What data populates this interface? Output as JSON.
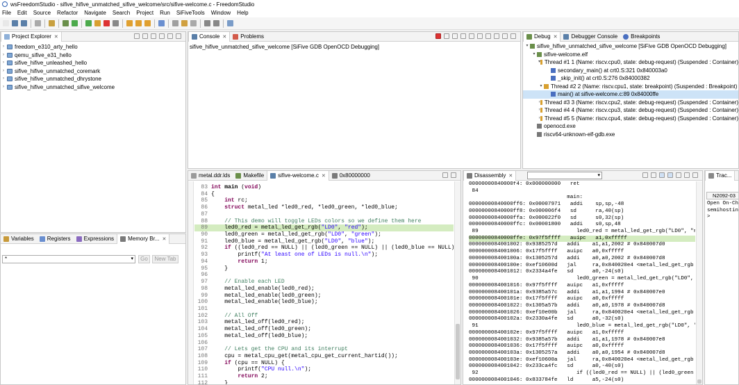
{
  "window": {
    "title": "wsFreedomStudio - sifive_hifive_unmatched_sifive_welcome/src/sifive-welcome.c - FreedomStudio"
  },
  "menu": [
    "File",
    "Edit",
    "Source",
    "Refactor",
    "Navigate",
    "Search",
    "Project",
    "Run",
    "SiFiveTools",
    "Window",
    "Help"
  ],
  "project_explorer": {
    "tab": "Project Explorer",
    "items": [
      "freedom_e310_arty_hello",
      "qemu_sifive_e31_hello",
      "sifive_hifive_unleashed_hello",
      "sifive_hifive_unmatched_coremark",
      "sifive_hifive_unmatched_dhrystone",
      "sifive_hifive_unmatched_sifive_welcome"
    ]
  },
  "console": {
    "tabs": [
      "Console",
      "Problems"
    ],
    "session": "sifive_hifive_unmatched_sifive_welcome [SiFive GDB OpenOCD Debugging]"
  },
  "debug": {
    "tabs": [
      "Debug",
      "Debugger Console",
      "Breakpoints"
    ],
    "rows": [
      {
        "indent": 0,
        "text": "sifive_hifive_unmatched_sifive_welcome [SiFive GDB OpenOCD Debugging]",
        "twisty": "▾"
      },
      {
        "indent": 1,
        "text": "sifive-welcome.elf",
        "twisty": "▾"
      },
      {
        "indent": 2,
        "text": "Thread #1 1 (Name: riscv.cpu0, state: debug-request) (Suspended : Container)",
        "twisty": "▾"
      },
      {
        "indent": 3,
        "text": "secondary_main() at crt0.S:321 0x840003a0",
        "twisty": ""
      },
      {
        "indent": 3,
        "text": "_skip_init() at crt0.S:276 0x84000382",
        "twisty": ""
      },
      {
        "indent": 2,
        "text": "Thread #2 2 (Name: riscv.cpu1, state: breakpoint) (Suspended : Breakpoint)",
        "twisty": "▾"
      },
      {
        "indent": 3,
        "text": "main() at sifive-welcome.c:89 0x84000ffe",
        "twisty": "",
        "selected": true
      },
      {
        "indent": 2,
        "text": "Thread #3 3 (Name: riscv.cpu2, state: debug-request) (Suspended : Container)",
        "twisty": "›"
      },
      {
        "indent": 2,
        "text": "Thread #4 4 (Name: riscv.cpu3, state: debug-request) (Suspended : Container)",
        "twisty": "›"
      },
      {
        "indent": 2,
        "text": "Thread #5 5 (Name: riscv.cpu4, state: debug-request) (Suspended : Container)",
        "twisty": "›"
      },
      {
        "indent": 1,
        "text": "openocd.exe",
        "twisty": ""
      },
      {
        "indent": 1,
        "text": "riscv64-unknown-elf-gdb.exe",
        "twisty": ""
      }
    ]
  },
  "variables": {
    "tabs": [
      "Variables",
      "Registers",
      "Expressions",
      "Memory Br..."
    ],
    "go": "Go",
    "new_tab": "New Tab",
    "combo_value": "*"
  },
  "editor": {
    "tabs": [
      "metal.ddr.lds",
      "Makefile",
      "sifive-welcome.c",
      "0x80000000"
    ],
    "lines": [
      {
        "n": "83",
        "html": "<span class=\"kw\">int</span> <b>main</b> (<span class=\"kw\">void</span>)"
      },
      {
        "n": "84",
        "html": "{"
      },
      {
        "n": "85",
        "html": "    <span class=\"kw\">int</span> rc;"
      },
      {
        "n": "86",
        "html": "    <span class=\"kw\">struct</span> metal_led *led0_red, *led0_green, *led0_blue;"
      },
      {
        "n": "87",
        "html": ""
      },
      {
        "n": "88",
        "html": "    <span class=\"cm\">// This demo will toggle LEDs colors so we define them here</span>"
      },
      {
        "n": "89",
        "html": "    led0_red = metal_led_get_rgb(<span class=\"st\">\"LD0\"</span>, <span class=\"st\">\"red\"</span>);",
        "hl": true
      },
      {
        "n": "90",
        "html": "    led0_green = metal_led_get_rgb(<span class=\"st\">\"LD0\"</span>, <span class=\"st\">\"green\"</span>);"
      },
      {
        "n": "91",
        "html": "    led0_blue = metal_led_get_rgb(<span class=\"st\">\"LD0\"</span>, <span class=\"st\">\"blue\"</span>);"
      },
      {
        "n": "92",
        "html": "    <span class=\"kw\">if</span> ((led0_red == NULL) || (led0_green == NULL) || (led0_blue == NULL)) {"
      },
      {
        "n": "93",
        "html": "        printf(<span class=\"st\">\"At least one of LEDs is null.\\n\"</span>);"
      },
      {
        "n": "94",
        "html": "        <span class=\"kw\">return</span> 1;"
      },
      {
        "n": "95",
        "html": "    }"
      },
      {
        "n": "96",
        "html": ""
      },
      {
        "n": "97",
        "html": "    <span class=\"cm\">// Enable each LED</span>"
      },
      {
        "n": "98",
        "html": "    metal_led_enable(led0_red);"
      },
      {
        "n": "99",
        "html": "    metal_led_enable(led0_green);"
      },
      {
        "n": "100",
        "html": "    metal_led_enable(led0_blue);"
      },
      {
        "n": "101",
        "html": ""
      },
      {
        "n": "102",
        "html": "    <span class=\"cm\">// All Off</span>"
      },
      {
        "n": "103",
        "html": "    metal_led_off(led0_red);"
      },
      {
        "n": "104",
        "html": "    metal_led_off(led0_green);"
      },
      {
        "n": "105",
        "html": "    metal_led_off(led0_blue);"
      },
      {
        "n": "106",
        "html": ""
      },
      {
        "n": "107",
        "html": "    <span class=\"cm\">// Lets get the CPU and its interrupt</span>"
      },
      {
        "n": "108",
        "html": "    cpu = metal_cpu_get(metal_cpu_get_current_hartid());"
      },
      {
        "n": "109",
        "html": "    <span class=\"kw\">if</span> (cpu == NULL) {"
      },
      {
        "n": "110",
        "html": "        printf(<span class=\"st\">\"CPU null.\\n\"</span>);"
      },
      {
        "n": "111",
        "html": "        <span class=\"kw\">return</span> 2;"
      },
      {
        "n": "112",
        "html": "    }"
      }
    ]
  },
  "disassembly": {
    "tab": "Disassembly",
    "lines": [
      {
        "t": "00000000840000f4: 0x000000000   ret"
      },
      {
        "t": " 84"
      },
      {
        "t": "                               main:"
      },
      {
        "t": "00000000840000ff6: 0x00007971   addi    sp,sp,-48"
      },
      {
        "t": "00000000840000ff8: 0x000006f4   sd      ra,40(sp)"
      },
      {
        "t": "00000000840000ffa: 0x000022f0   sd      s0,32(sp)"
      },
      {
        "t": "00000000840000ffc: 0x00001800   addi    s0,sp,48"
      },
      {
        "t": " 89                               led0_red = metal_led_get_rgb(\"LD0\", \"r"
      },
      {
        "t": "00000000840000ffe: 0x97f5ffff   auipc   a1,0xfffff",
        "cur": true
      },
      {
        "t": "0000000084001002: 0x9385257d   addi    a1,a1,2002 # 0x840007d0"
      },
      {
        "t": "0000000084001006: 0x17f5ffff   auipc   a0,0xfffff"
      },
      {
        "t": "000000008400100a: 0x1305257d   addi    a0,a0,2002 # 0x840007d8"
      },
      {
        "t": "000000008400100e: 0xef10600d   jal     ra,0x840020e4 <metal_led_get_rgb"
      },
      {
        "t": "0000000084001012: 0x2334a4fe   sd      a0,-24(s0)"
      },
      {
        "t": " 90                               led0_green = metal_led_get_rgb(\"LD0\","
      },
      {
        "t": "0000000084001016: 0x97f5ffff   auipc   a1,0xfffff"
      },
      {
        "t": "000000008400101a: 0x9385a57c   addi    a1,a1,1994 # 0x840007e0"
      },
      {
        "t": "000000008400101e: 0x17f5ffff   auipc   a0,0xfffff"
      },
      {
        "t": "0000000084001022: 0x1305a57b   addi    a0,a0,1978 # 0x840007d8"
      },
      {
        "t": "0000000084001026: 0xef10e00b   jal     ra,0x840020e4 <metal_led_get_rgb"
      },
      {
        "t": "000000008400102a: 0x2330a4fe   sd      a0,-32(s0)"
      },
      {
        "t": " 91                               led0_blue = metal_led_get_rgb(\"LD0\", '"
      },
      {
        "t": "000000008400102e: 0x97f5ffff   auipc   a1,0xfffff"
      },
      {
        "t": "0000000084001032: 0x9385a57b   addi    a1,a1,1978 # 0x840007e8"
      },
      {
        "t": "0000000084001036: 0x17f5ffff   auipc   a0,0xfffff"
      },
      {
        "t": "000000008400103a: 0x1305257a   addi    a0,a0,1954 # 0x840007d8"
      },
      {
        "t": "000000008400103e: 0xef10600a   jal     ra,0x840020e4 <metal_led_get_rgb"
      },
      {
        "t": "0000000084001042: 0x233ca4fc   sd      a0,-40(s0)"
      },
      {
        "t": " 92                               if ((led0_red == NULL) || (led0_green"
      },
      {
        "t": "0000000084001046: 0x833784fe   ld      a5,-24(s0)"
      },
      {
        "t": "000000008400104a: 0x0000099c7   beqz    a5,0x84001058 <main+98>"
      }
    ]
  },
  "trace": {
    "tab": "Trac...",
    "subtab": "N2092-03",
    "lines": [
      "Open On-Chi",
      "semihosting",
      ">"
    ]
  }
}
